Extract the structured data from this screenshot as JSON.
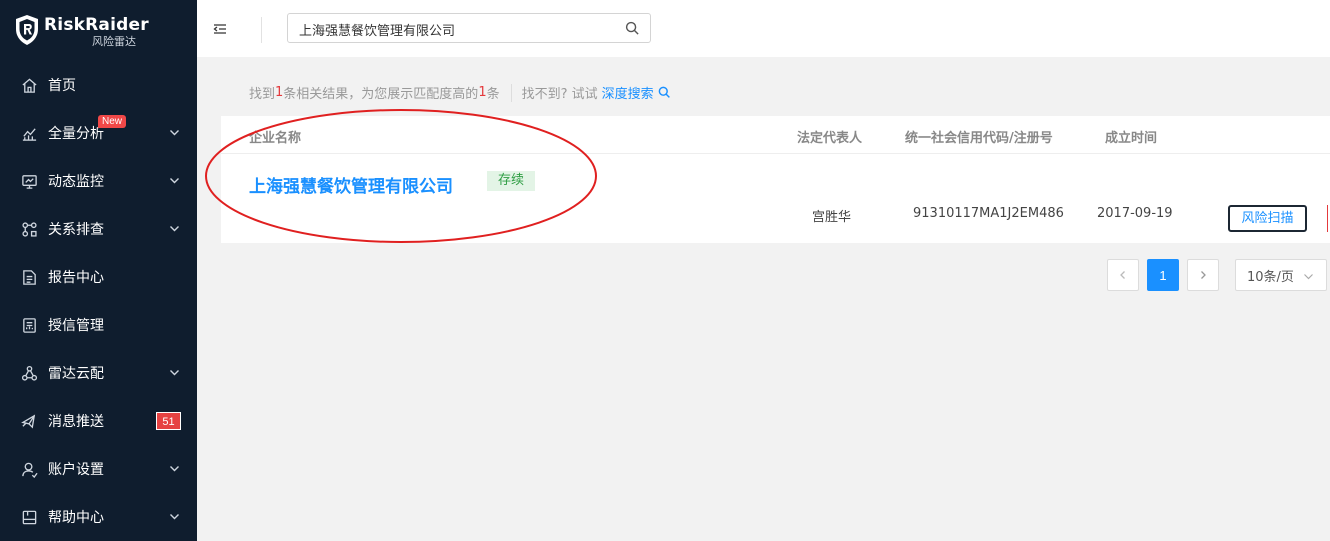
{
  "app": {
    "logo_title": "RiskRaider",
    "logo_subtitle": "风险雷达"
  },
  "sidebar": {
    "items": [
      {
        "label": "首页",
        "icon": "home-icon"
      },
      {
        "label": "全量分析",
        "icon": "analysis-icon",
        "badge": "New",
        "expandable": true
      },
      {
        "label": "动态监控",
        "icon": "monitor-icon",
        "expandable": true
      },
      {
        "label": "关系排查",
        "icon": "relation-icon",
        "expandable": true
      },
      {
        "label": "报告中心",
        "icon": "report-icon"
      },
      {
        "label": "授信管理",
        "icon": "credit-icon"
      },
      {
        "label": "雷达云配",
        "icon": "cloud-config-icon",
        "expandable": true
      },
      {
        "label": "消息推送",
        "icon": "message-icon",
        "count": "51"
      },
      {
        "label": "账户设置",
        "icon": "user-icon",
        "expandable": true
      },
      {
        "label": "帮助中心",
        "icon": "help-icon",
        "expandable": true
      }
    ]
  },
  "search": {
    "value": "上海强慧餐饮管理有限公司"
  },
  "summary": {
    "part1": "找到",
    "found_count": "1",
    "part2": "条相关结果，为您展示匹配度高的",
    "shown_count": "1",
    "part3": "条",
    "not_found": "找不到? 试试",
    "deep_search": "深度搜索"
  },
  "table": {
    "headers": {
      "company": "企业名称",
      "legal_rep": "法定代表人",
      "credit_code": "统一社会信用代码/注册号",
      "founded": "成立时间"
    },
    "rows": [
      {
        "company": "上海强慧餐饮管理有限公司",
        "status": "存续",
        "legal_rep": "宫胜华",
        "credit_code": "91310117MA1J2EM486",
        "founded": "2017-09-19",
        "action": "风险扫描"
      }
    ]
  },
  "pagination": {
    "current_page": "1",
    "page_size": "10条/页"
  },
  "colors": {
    "sidebar_bg": "#0f1d2e",
    "accent": "#1a90ff",
    "highlight": "#e4393c",
    "status_green": "#2f9e44",
    "annotation_red": "#e02020"
  }
}
